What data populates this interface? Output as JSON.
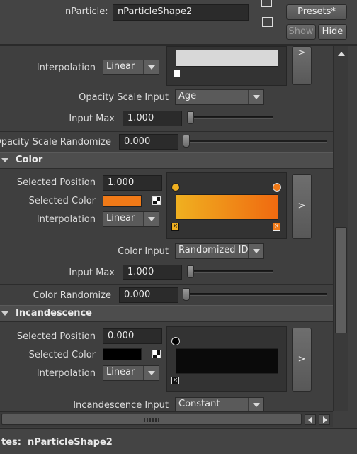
{
  "header": {
    "node_label": "nParticle:",
    "node_value": "nParticleShape2",
    "presets_label": "Presets*",
    "show_label": "Show",
    "hide_label": "Hide"
  },
  "opacity": {
    "interpolation_label": "Interpolation",
    "interpolation_value": "Linear",
    "scale_input_label": "Opacity Scale Input",
    "scale_input_value": "Age",
    "input_max_label": "Input Max",
    "input_max_value": "1.000",
    "input_max_level": 0.0,
    "randomize_label": "Opacity Scale Randomize",
    "randomize_value": "0.000",
    "randomize_level": 0.0
  },
  "color_section": {
    "title": "Color",
    "selected_position_label": "Selected Position",
    "selected_position_value": "1.000",
    "selected_color_label": "Selected Color",
    "selected_color_hex": "#f07a18",
    "interpolation_label": "Interpolation",
    "interpolation_value": "Linear",
    "ramp_start_hex": "#f0b020",
    "ramp_end_hex": "#f06a10",
    "expand_label": ">",
    "color_input_label": "Color Input",
    "color_input_value": "Randomized ID",
    "input_max_label": "Input Max",
    "input_max_value": "1.000",
    "input_max_level": 0.0,
    "randomize_label": "Color Randomize",
    "randomize_value": "0.000",
    "randomize_level": 0.0
  },
  "incandescence_section": {
    "title": "Incandescence",
    "selected_position_label": "Selected Position",
    "selected_position_value": "0.000",
    "selected_color_label": "Selected Color",
    "selected_color_hex": "#000000",
    "interpolation_label": "Interpolation",
    "interpolation_value": "Linear",
    "expand_label": ">",
    "input_label": "Incandescence Input",
    "input_value": "Constant"
  },
  "status": {
    "text": "tes:  nParticleShape2"
  }
}
